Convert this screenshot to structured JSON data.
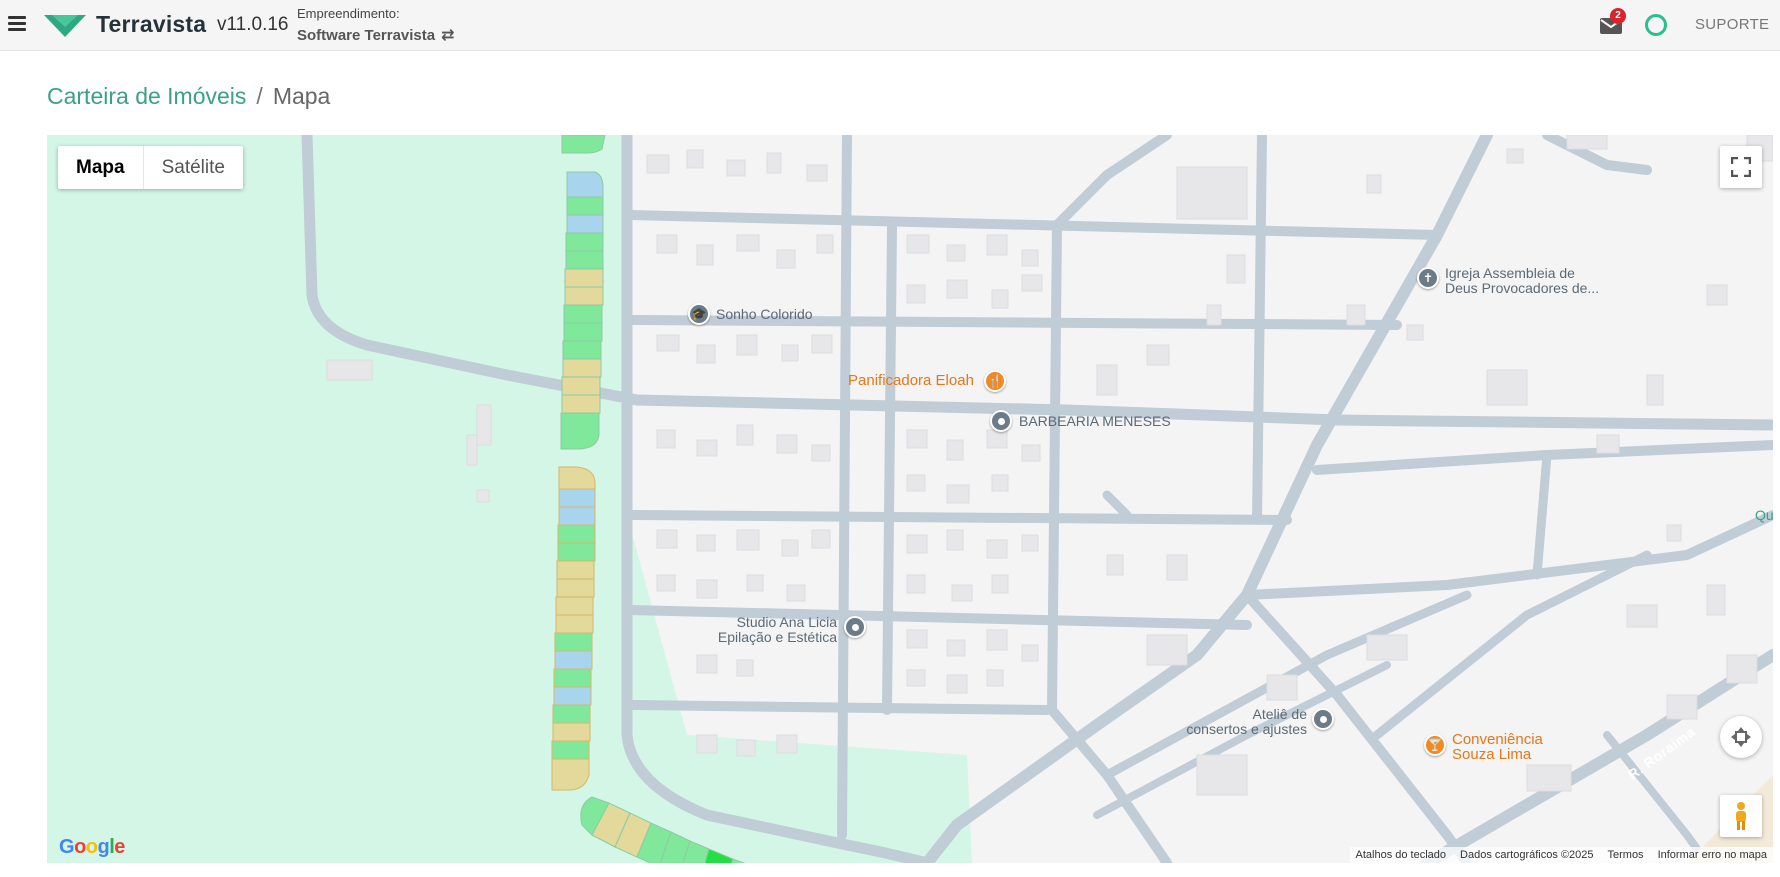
{
  "header": {
    "brand": "Terravista",
    "version": "v11.0.16",
    "empreendimento_label": "Empreendimento:",
    "empreendimento_name": "Software Terravista",
    "switch_icon": "⇄",
    "mail_badge": "2",
    "support_label": "SUPORTE"
  },
  "breadcrumb": {
    "parent": "Carteira de Imóveis",
    "separator": "/",
    "current": "Mapa"
  },
  "map": {
    "type_buttons": {
      "map": "Mapa",
      "satellite": "Satélite"
    },
    "pois": {
      "school": "Sonho Colorido",
      "bakery": "Panificadora Eloah",
      "barber": "BARBEARIA MENESES",
      "church_line1": "Igreja Assembleia de",
      "church_line2": "Deus Provocadores de...",
      "studio_line1": "Studio Ana Licia",
      "studio_line2": "Epilação e Estética",
      "atelie_line1": "Ateliê de",
      "atelie_line2": "consertos e ajustes",
      "conv_line1": "Conveniência",
      "conv_line2": "Souza Lima"
    },
    "road_label": "R. Roraima",
    "edge_label": "Qu",
    "google_logo": [
      "G",
      "o",
      "o",
      "g",
      "l",
      "e"
    ],
    "attribution": {
      "shortcuts": "Atalhos do teclado",
      "data": "Dados cartográficos ©2025",
      "terms": "Termos",
      "report": "Informar erro no mapa"
    }
  },
  "colors": {
    "accent": "#3aa187",
    "park": "#d4f6e6",
    "road": "#c0ccd6",
    "lot_green": "#7fe89a",
    "lot_blue": "#a8d4ee",
    "lot_yellow": "#e2d99a"
  },
  "lot_statuses_strip1": [
    "green",
    "blue",
    "green",
    "blue",
    "green",
    "green",
    "yellow",
    "yellow",
    "green",
    "green",
    "green",
    "yellow",
    "yellow",
    "yellow",
    "green"
  ],
  "lot_statuses_strip2": [
    "yellow",
    "blue",
    "blue",
    "green",
    "green",
    "yellow",
    "yellow",
    "yellow",
    "yellow",
    "green",
    "blue",
    "green",
    "blue",
    "green",
    "yellow",
    "green",
    "yellow"
  ],
  "lot_statuses_strip3": [
    "green",
    "yellow",
    "yellow",
    "green",
    "green",
    "green",
    "bright-green",
    "green"
  ]
}
